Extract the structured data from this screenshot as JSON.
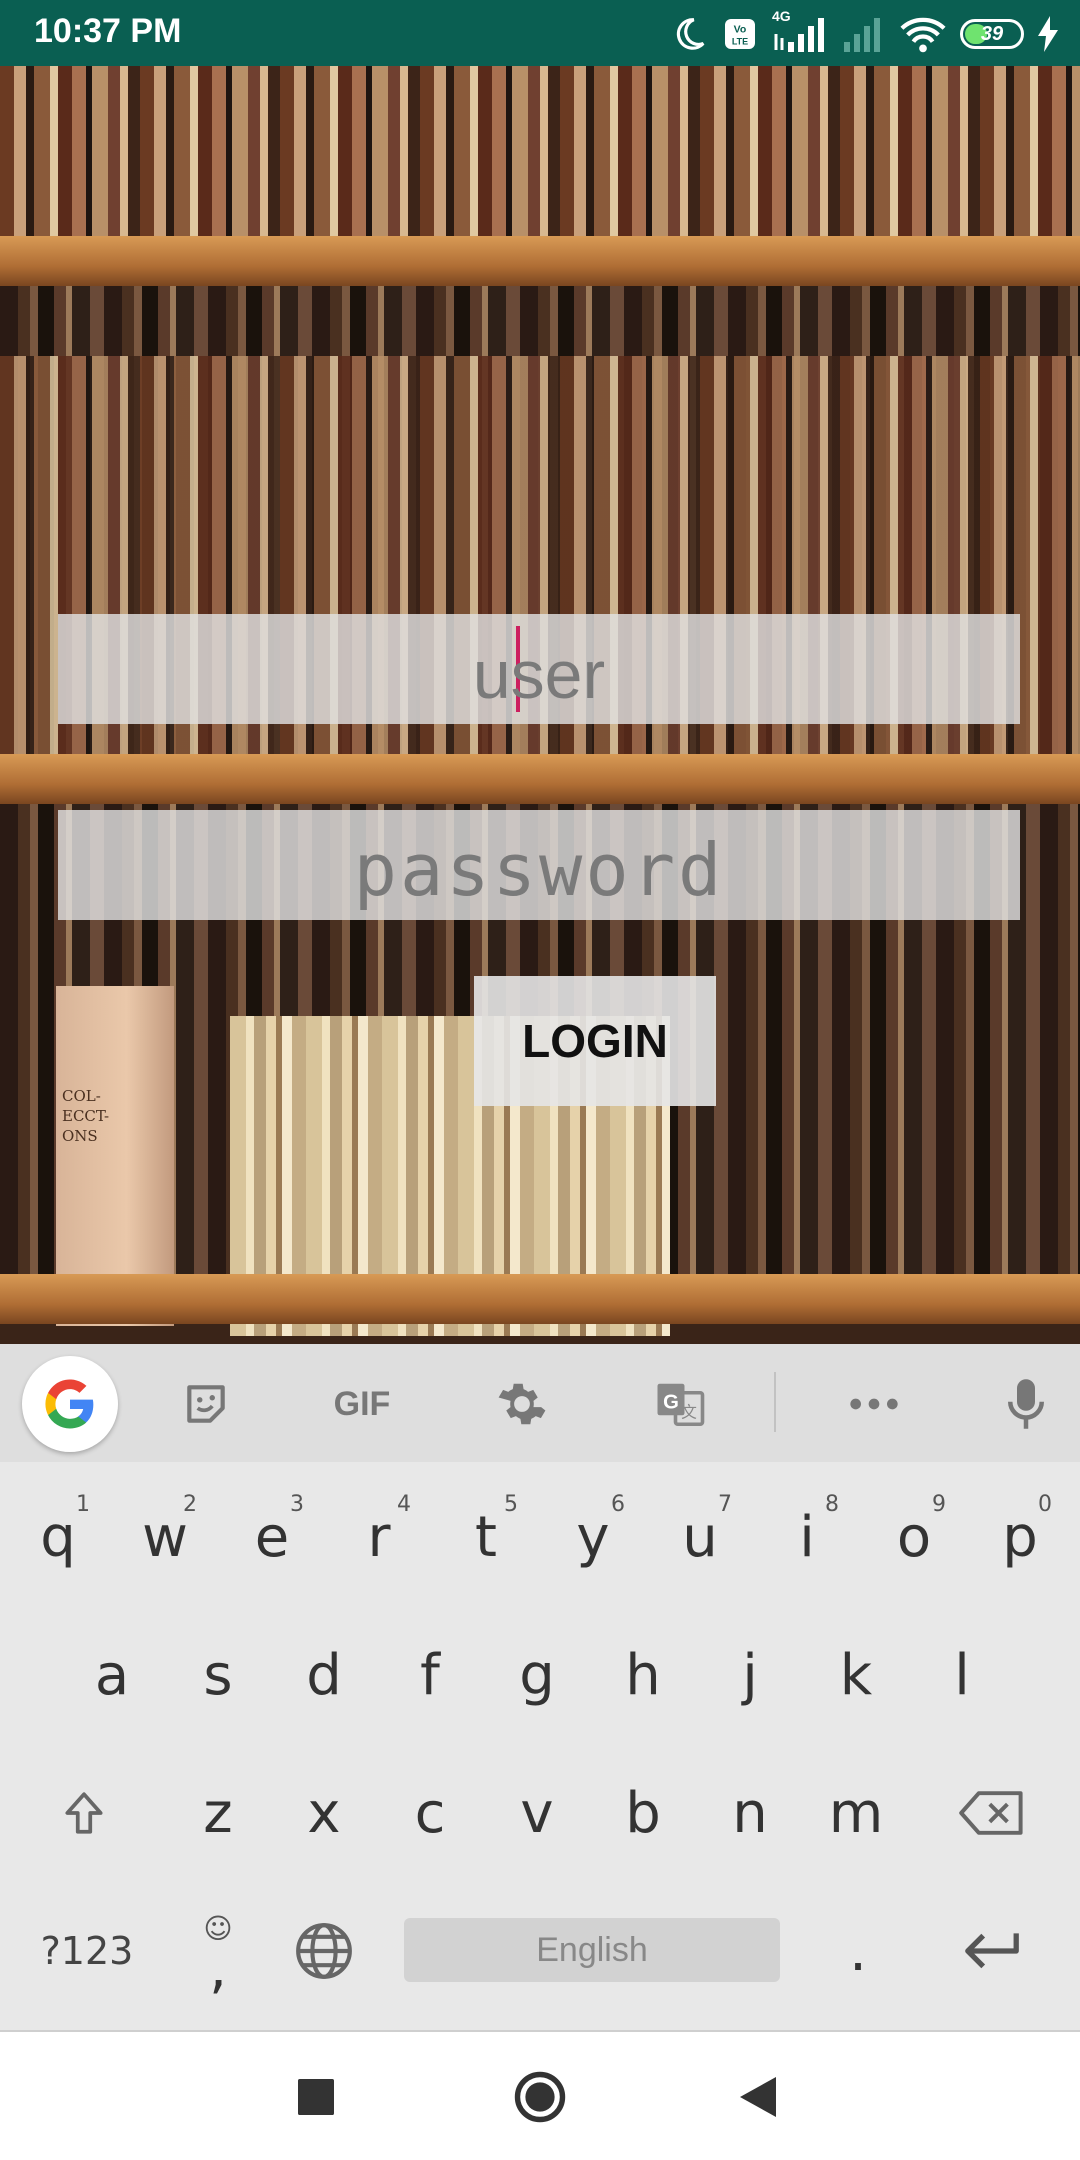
{
  "status_bar": {
    "time": "10:37 PM",
    "network_label": "4G",
    "volte_label": "Vo LTE",
    "battery_level": "39",
    "icons": [
      "moon-icon",
      "volte-icon",
      "signal-icon",
      "signal-empty-icon",
      "wifi-icon",
      "battery-icon",
      "charging-icon"
    ]
  },
  "login_form": {
    "user_placeholder": "user",
    "password_placeholder": "password",
    "login_label": "LOGIN"
  },
  "background": {
    "book_spine_text": "COL- ECCT- ONS"
  },
  "keyboard": {
    "toolbar_icons": [
      "google-icon",
      "sticker-icon",
      "gif-icon",
      "settings-icon",
      "translate-icon",
      "more-icon",
      "mic-icon"
    ],
    "gif_label": "GIF",
    "row1": [
      "q",
      "w",
      "e",
      "r",
      "t",
      "y",
      "u",
      "i",
      "o",
      "p"
    ],
    "row1_hints": [
      "1",
      "2",
      "3",
      "4",
      "5",
      "6",
      "7",
      "8",
      "9",
      "0"
    ],
    "row2": [
      "a",
      "s",
      "d",
      "f",
      "g",
      "h",
      "j",
      "k",
      "l"
    ],
    "row3": [
      "z",
      "x",
      "c",
      "v",
      "b",
      "n",
      "m"
    ],
    "symbols_label": "?123",
    "comma_label": ",",
    "space_label": "English",
    "period_label": "."
  },
  "nav_bar": {
    "icons": [
      "recents-icon",
      "home-icon",
      "back-icon"
    ]
  }
}
